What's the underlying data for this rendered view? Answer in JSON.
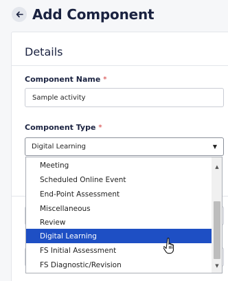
{
  "header": {
    "back_icon": "arrow-left-icon",
    "title": "Add Component"
  },
  "details": {
    "section_title": "Details",
    "component_name": {
      "label": "Component Name",
      "required_mark": "*",
      "value": "Sample activity"
    },
    "component_type": {
      "label": "Component Type",
      "required_mark": "*",
      "selected_value": "Digital Learning",
      "caret_icon": "caret-down-icon",
      "options": [
        {
          "label": "Meeting",
          "selected": false
        },
        {
          "label": "Scheduled Online Event",
          "selected": false
        },
        {
          "label": "End-Point Assessment",
          "selected": false
        },
        {
          "label": "Miscellaneous",
          "selected": false
        },
        {
          "label": "Review",
          "selected": false
        },
        {
          "label": "Digital Learning",
          "selected": true
        },
        {
          "label": "FS Initial Assessment",
          "selected": false
        },
        {
          "label": "FS Diagnostic/Revision",
          "selected": false
        }
      ]
    }
  },
  "colors": {
    "accent": "#1e4fc4",
    "title_text": "#1a2240",
    "required": "#d33a3a"
  }
}
